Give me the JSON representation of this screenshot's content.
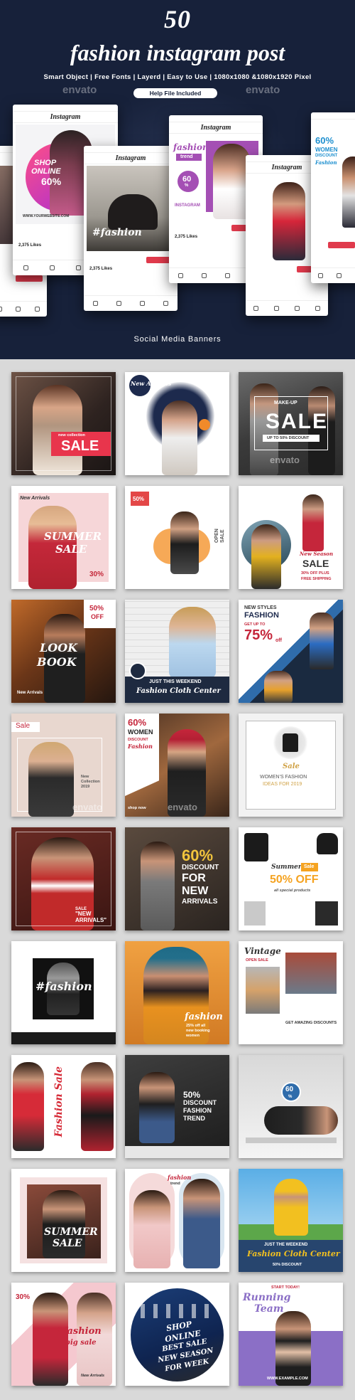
{
  "header": {
    "number": "50",
    "title": "fashion instagram post",
    "subtitle": "Smart Object | Free Fonts | Layerd | Easy to Use | 1080x1080 &1080x1920 Pixel",
    "help_pill": "Help File Included",
    "watermark": "envato",
    "footer_caption": "Social Media Banners"
  },
  "phones": {
    "app_title": "Instagram",
    "p1": {
      "l1": "SHOP",
      "l2": "ONLINE",
      "l3": "60%",
      "url": "WWW.YOURWEBSITE.COM",
      "likes": "2,375 Likes"
    },
    "p2": {
      "text": "#fashion",
      "likes": "2,375 Likes"
    },
    "p3": {
      "script": "fashion",
      "badge_big": "60",
      "badge_small": "%",
      "trend": "trend",
      "likes": "2,375 Likes",
      "insta": "INSTAGRAM"
    },
    "p4": {
      "l1": "60%",
      "l2": "WOMEN",
      "l3": "DISCOUNT",
      "l4": "Fashion"
    }
  },
  "tiles": [
    {
      "id": 1,
      "texts": [
        "SALE",
        "new collection"
      ]
    },
    {
      "id": 2,
      "texts": [
        "New Arrivals"
      ]
    },
    {
      "id": 3,
      "texts": [
        "MAKE-UP",
        "SALE",
        "UP TO 50% DISCOUNT"
      ]
    },
    {
      "id": 4,
      "texts": [
        "New Arrivals",
        "SUMMER",
        "SALE",
        "30%"
      ]
    },
    {
      "id": 5,
      "texts": [
        "50%",
        "OPEN SALE"
      ]
    },
    {
      "id": 6,
      "texts": [
        "New Season",
        "SALE",
        "30% OFF PLUS",
        "FREE SHIPPING"
      ]
    },
    {
      "id": 7,
      "texts": [
        "50%",
        "OFF",
        "LOOK",
        "BOOK",
        "New Arrivals"
      ]
    },
    {
      "id": 8,
      "texts": [
        "JUST THIS WEEKEND",
        "Fashion Cloth Center"
      ]
    },
    {
      "id": 9,
      "texts": [
        "NEW STYLES",
        "FASHION",
        "GET UP TO",
        "75%",
        "off"
      ]
    },
    {
      "id": 10,
      "texts": [
        "Sale",
        "New",
        "Collection",
        "2019"
      ]
    },
    {
      "id": 11,
      "texts": [
        "60%",
        "WOMEN",
        "DISCOUNT",
        "Fashion",
        "shop now"
      ]
    },
    {
      "id": 12,
      "texts": [
        "Sale",
        "WOMEN'S FASHION",
        "IDEAS FOR 2019"
      ]
    },
    {
      "id": 13,
      "texts": [
        "SALE",
        "\"NEW",
        "ARRIVALS\""
      ]
    },
    {
      "id": 14,
      "texts": [
        "60%",
        "DISCOUNT",
        "FOR",
        "NEW",
        "ARRIVALS"
      ]
    },
    {
      "id": 15,
      "texts": [
        "Summer",
        "Sale",
        "50% OFF",
        "all special products"
      ]
    },
    {
      "id": 16,
      "texts": [
        "#fashion"
      ]
    },
    {
      "id": 17,
      "texts": [
        "fashion",
        "25% off all",
        "new booking",
        "women"
      ]
    },
    {
      "id": 18,
      "texts": [
        "Vintage",
        "OPEN SALE",
        "GET AMAZING DISCOUNTS"
      ]
    },
    {
      "id": 19,
      "texts": [
        "Fashion Sale"
      ]
    },
    {
      "id": 20,
      "texts": [
        "50%",
        "DISCOUNT",
        "FASHION",
        "TREND"
      ]
    },
    {
      "id": 21,
      "texts": [
        "60",
        "%"
      ]
    },
    {
      "id": 22,
      "texts": [
        "SUMMER",
        "SALE"
      ]
    },
    {
      "id": 23,
      "texts": [
        "fashion",
        "trend"
      ]
    },
    {
      "id": 24,
      "texts": [
        "JUST THE WEEKEND",
        "Fashion Cloth Center",
        "50% DISCOUNT"
      ]
    },
    {
      "id": 25,
      "texts": [
        "30%",
        "#fashion",
        "big sale",
        "New Arrivals"
      ]
    },
    {
      "id": 26,
      "texts": [
        "SHOP",
        "ONLINE",
        "BEST SALE",
        "NEW SEASON",
        "FOR WEEK"
      ]
    },
    {
      "id": 27,
      "texts": [
        "START TODAY!",
        "Running",
        "Team",
        "WWW.EXAMPLE.COM"
      ]
    }
  ]
}
